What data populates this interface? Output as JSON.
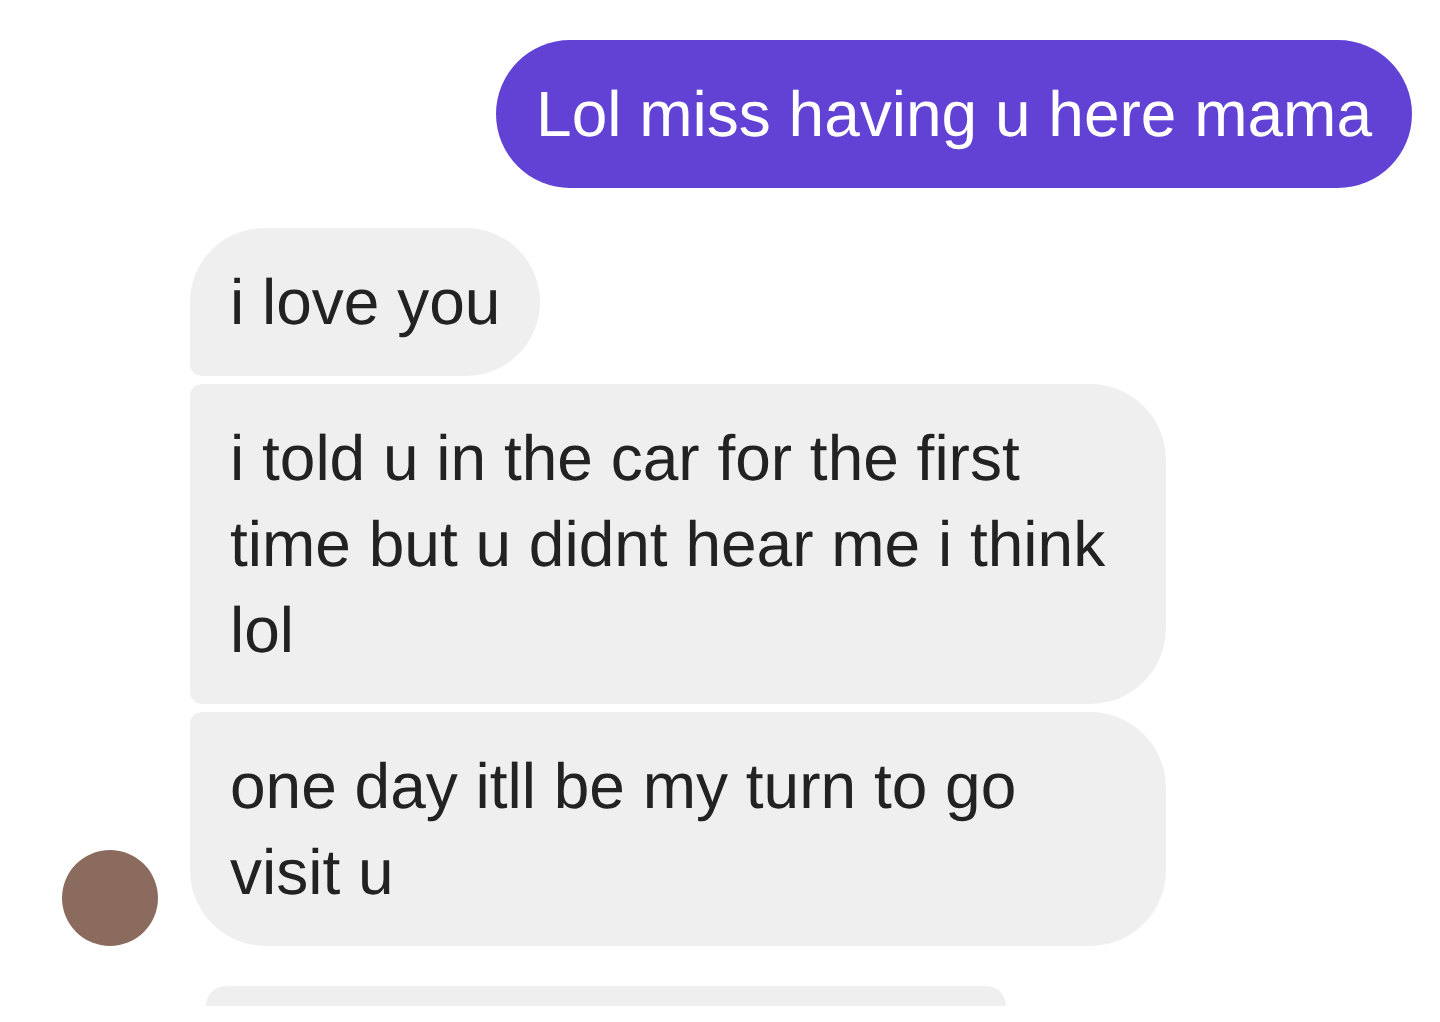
{
  "groups": [
    {
      "kind": "sent",
      "avatar": false,
      "messages": [
        {
          "kind": "text",
          "text": "Lol miss having u here mama"
        }
      ]
    },
    {
      "kind": "received",
      "avatar": true,
      "messages": [
        {
          "kind": "text",
          "text": "i love you"
        },
        {
          "kind": "text",
          "text": "i told u in the car for the first time but u didnt hear me i think lol"
        },
        {
          "kind": "text",
          "text": "one day itll be my turn to go visit u"
        }
      ]
    },
    {
      "kind": "received",
      "avatar": false,
      "messages": [
        {
          "kind": "clipped"
        }
      ]
    }
  ]
}
